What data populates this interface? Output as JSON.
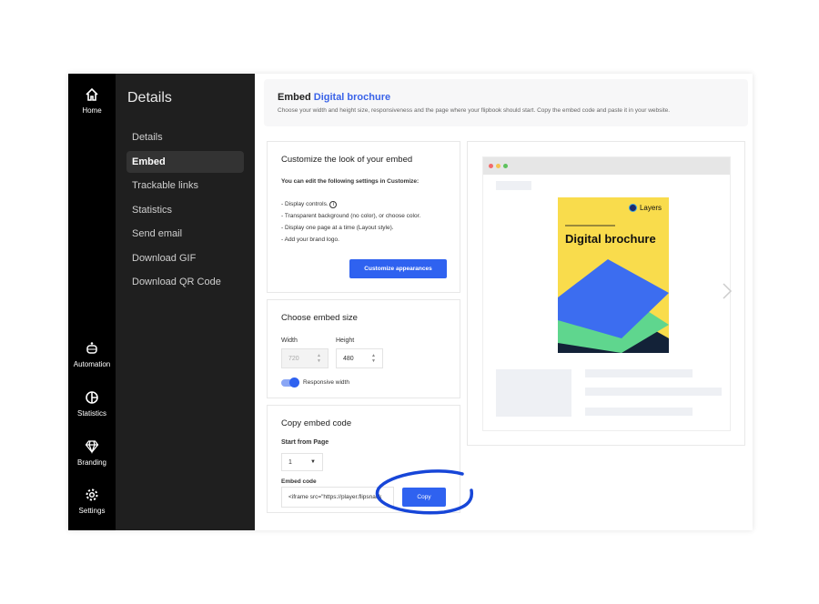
{
  "rail": [
    {
      "label": "Home",
      "icon": "home-icon"
    },
    {
      "label": "Automation",
      "icon": "robot-icon"
    },
    {
      "label": "Statistics",
      "icon": "pie-chart-icon"
    },
    {
      "label": "Branding",
      "icon": "diamond-icon"
    },
    {
      "label": "Settings",
      "icon": "gear-icon"
    }
  ],
  "sidebar": {
    "title": "Details",
    "items": [
      "Details",
      "Embed",
      "Trackable links",
      "Statistics",
      "Send email",
      "Download GIF",
      "Download QR Code"
    ],
    "active": "Embed"
  },
  "header": {
    "title_prefix": "Embed",
    "title_name": "Digital brochure",
    "subtitle": "Choose your width and height size, responsiveness and the page where your flipbook should start. Copy the embed code and paste it in your website."
  },
  "customize": {
    "title": "Customize the look of your embed",
    "intro": "You can edit the following settings in Customize:",
    "items": [
      "- Display controls.",
      "- Transparent background (no color), or choose color.",
      "- Display one page at a time (Layout style).",
      "- Add your brand logo."
    ],
    "button": "Customize appearances"
  },
  "size": {
    "title": "Choose embed size",
    "width_label": "Width",
    "width_value": "720",
    "height_label": "Height",
    "height_value": "480",
    "responsive_label": "Responsive width",
    "responsive_on": true
  },
  "code": {
    "title": "Copy embed code",
    "start_label": "Start from Page",
    "start_value": "1",
    "embed_label": "Embed code",
    "embed_value": "<iframe src=\"https://player.flipsnack",
    "copy": "Copy"
  },
  "brochure": {
    "brand": "Layers",
    "title": "Digital brochure",
    "cover_color": "#f9dc4c"
  },
  "colors": {
    "accent": "#2f62f0",
    "annotation": "#1746d8"
  }
}
